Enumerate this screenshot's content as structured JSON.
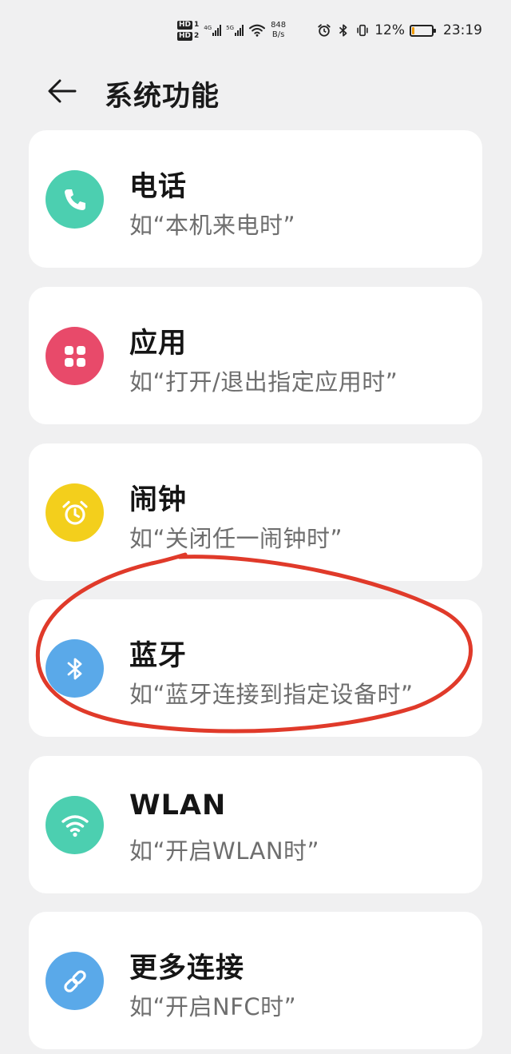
{
  "status_bar": {
    "sim1": "HD",
    "sim1_slot": "1",
    "sim2": "HD",
    "sim2_slot": "2",
    "net1": "4G",
    "net2": "5G",
    "speed_value": "848",
    "speed_unit": "B/s",
    "battery_percent_text": "12%",
    "battery_level": 0.12,
    "time": "23:19",
    "icons": [
      "alarm-icon",
      "bluetooth-icon",
      "vibrate-icon",
      "battery-icon"
    ]
  },
  "header": {
    "title": "系统功能",
    "back_icon": "arrow-left-icon"
  },
  "items": [
    {
      "name": "电话",
      "desc": "如“本机来电时”",
      "icon": "phone-icon",
      "color": "#4ccfb0"
    },
    {
      "name": "应用",
      "desc": "如“打开/退出指定应用时”",
      "icon": "apps-grid-icon",
      "color": "#e84a6a"
    },
    {
      "name": "闹钟",
      "desc": "如“关闭任一闹钟时”",
      "icon": "alarm-clock-icon",
      "color": "#f3cf1c"
    },
    {
      "name": "蓝牙",
      "desc": "如“蓝牙连接到指定设备时”",
      "icon": "bluetooth-icon",
      "color": "#5aa9e9"
    },
    {
      "name": "WLAN",
      "desc": "如“开启WLAN时”",
      "icon": "wifi-icon",
      "color": "#4ccfb0"
    },
    {
      "name": "更多连接",
      "desc": "如“开启NFC时”",
      "icon": "link-icon",
      "color": "#5aa9e9"
    }
  ],
  "annotation": {
    "color": "#e03a2a",
    "highlight": "蓝牙"
  }
}
